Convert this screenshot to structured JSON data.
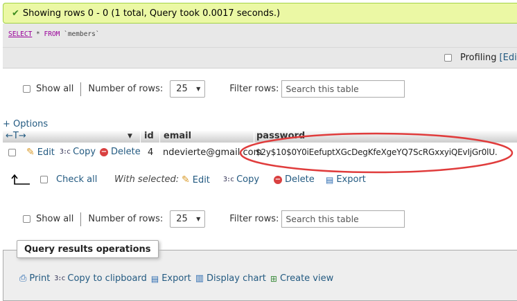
{
  "success": {
    "message": "Showing rows 0 - 0 (1 total, Query took 0.0017 seconds.)"
  },
  "sql": {
    "kw_select": "SELECT",
    "star": " * ",
    "kw_from": "FROM",
    "table": " `members`"
  },
  "profiling": {
    "label": "Profiling",
    "edit_link": "[Edit"
  },
  "nav": {
    "show_all": "Show all",
    "number_of_rows_label": "Number of rows:",
    "number_of_rows_value": "25",
    "filter_label": "Filter rows:",
    "filter_placeholder": "Search this table"
  },
  "options_link": "+ Options",
  "table": {
    "arrows": "←T→",
    "columns": [
      "id",
      "email",
      "password"
    ],
    "rows": [
      {
        "id": "4",
        "email": "ndevierte@gmail.com",
        "password": "$2y$10$0Y0iEefuptXGcDegKfeXgeYQ7ScRGxxyiQEvIjGr0lU."
      }
    ],
    "row_actions": {
      "edit": "Edit",
      "copy": "Copy",
      "delete": "Delete"
    }
  },
  "with_selected": {
    "check_all": "Check all",
    "label": "With selected:",
    "edit": "Edit",
    "copy": "Copy",
    "delete": "Delete",
    "export": "Export"
  },
  "query_results_ops": {
    "title": "Query results operations",
    "print": "Print",
    "copy_clipboard": "Copy to clipboard",
    "export": "Export",
    "display_chart": "Display chart",
    "create_view": "Create view"
  },
  "colors": {
    "link": "#235a81",
    "success_bg": "#ebf8a4",
    "annotation": "#e03c3c"
  }
}
